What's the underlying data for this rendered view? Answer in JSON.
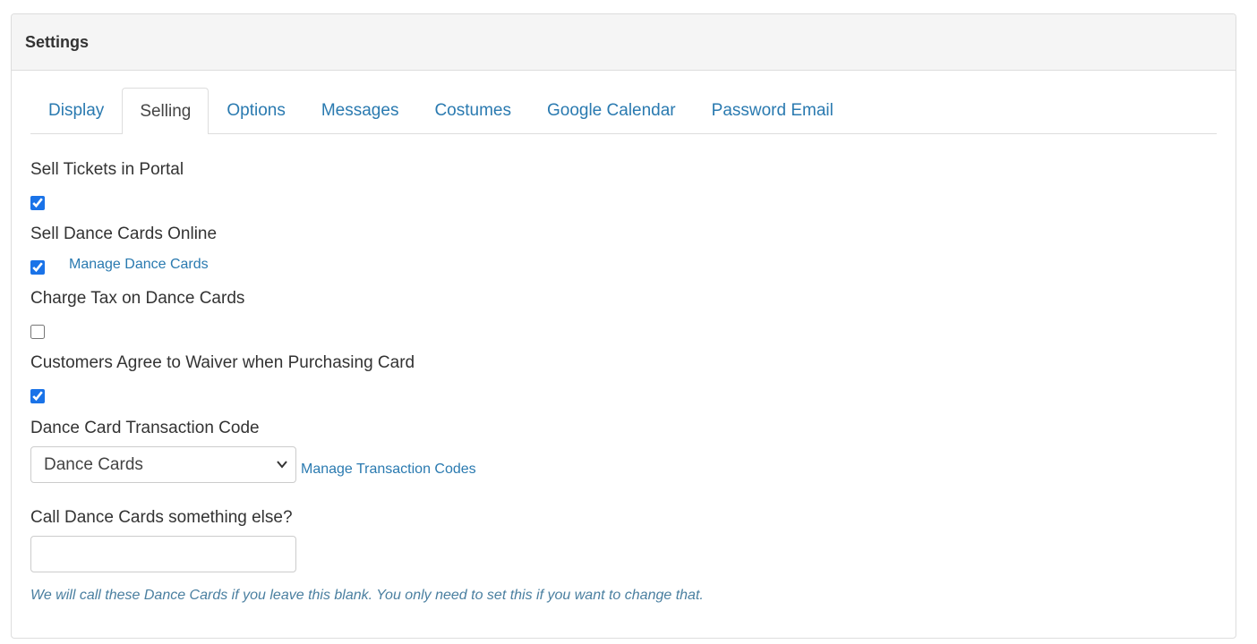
{
  "panel": {
    "title": "Settings"
  },
  "tabs": [
    {
      "label": "Display",
      "active": false
    },
    {
      "label": "Selling",
      "active": true
    },
    {
      "label": "Options",
      "active": false
    },
    {
      "label": "Messages",
      "active": false
    },
    {
      "label": "Costumes",
      "active": false
    },
    {
      "label": "Google Calendar",
      "active": false
    },
    {
      "label": "Password Email",
      "active": false
    }
  ],
  "settings": {
    "sell_tickets": {
      "label": "Sell Tickets in Portal",
      "checked": true
    },
    "sell_dance_cards": {
      "label": "Sell Dance Cards Online",
      "checked": true,
      "link": "Manage Dance Cards"
    },
    "charge_tax": {
      "label": "Charge Tax on Dance Cards",
      "checked": false
    },
    "waiver": {
      "label": "Customers Agree to Waiver when Purchasing Card",
      "checked": true
    },
    "transaction_code": {
      "label": "Dance Card Transaction Code",
      "selected": "Dance Cards",
      "link": "Manage Transaction Codes"
    },
    "rename": {
      "label": "Call Dance Cards something else?",
      "value": "",
      "placeholder": "",
      "help": "We will call these Dance Cards if you leave this blank. You only need to set this if you want to change that."
    }
  },
  "colors": {
    "link": "#2a7ab0",
    "arrow": "#ee1111",
    "checkbox": "#1a73e8"
  },
  "icons": {
    "select": "chevron-down-icon",
    "annotation": "red-arrow-icon"
  }
}
